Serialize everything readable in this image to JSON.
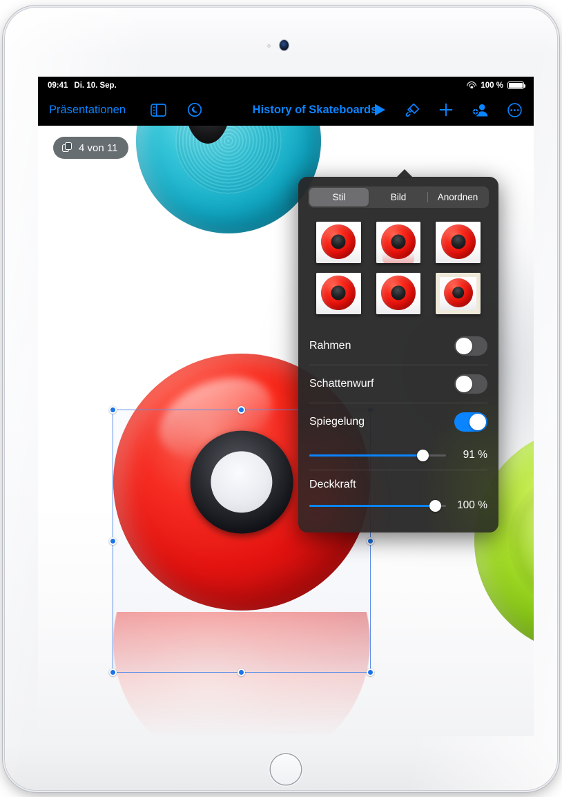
{
  "status_bar": {
    "time": "09:41",
    "date": "Di. 10. Sep.",
    "wifi_icon": "wifi-icon",
    "battery_percent": "100 %",
    "battery_icon": "battery-icon"
  },
  "toolbar": {
    "back_label": "Präsentationen",
    "sidebar_icon": "sidebar-icon",
    "undo_icon": "undo-icon",
    "title": "History of Skateboards",
    "play_icon": "play-icon",
    "format_icon": "brush-icon",
    "insert_icon": "plus-icon",
    "collaborate_icon": "add-person-icon",
    "more_icon": "ellipsis-circle-icon"
  },
  "canvas": {
    "slide_counter": "4 von 11",
    "slide_counter_icon": "slides-icon"
  },
  "popover": {
    "tabs": [
      {
        "label": "Stil",
        "selected": true
      },
      {
        "label": "Bild",
        "selected": false
      },
      {
        "label": "Anordnen",
        "selected": false
      }
    ],
    "styles": [
      {
        "name": "style-1",
        "selected": false
      },
      {
        "name": "style-2",
        "selected": false
      },
      {
        "name": "style-3",
        "selected": false
      },
      {
        "name": "style-4",
        "selected": false
      },
      {
        "name": "style-5",
        "selected": false
      },
      {
        "name": "style-6",
        "selected": true
      }
    ],
    "rows": [
      {
        "label": "Rahmen",
        "toggle": "off"
      },
      {
        "label": "Schattenwurf",
        "toggle": "off"
      },
      {
        "label": "Spiegelung",
        "toggle": "on"
      }
    ],
    "reflection_value": "91 %",
    "opacity_label": "Deckkraft",
    "opacity_value": "100 %"
  },
  "colors": {
    "accent_blue": "#0a84ff",
    "tint_blue": "#1a73e8",
    "panel_bg": "#282828",
    "segment_active": "#6e6e71",
    "toggle_off": "#545456",
    "screen_black": "#000000"
  }
}
